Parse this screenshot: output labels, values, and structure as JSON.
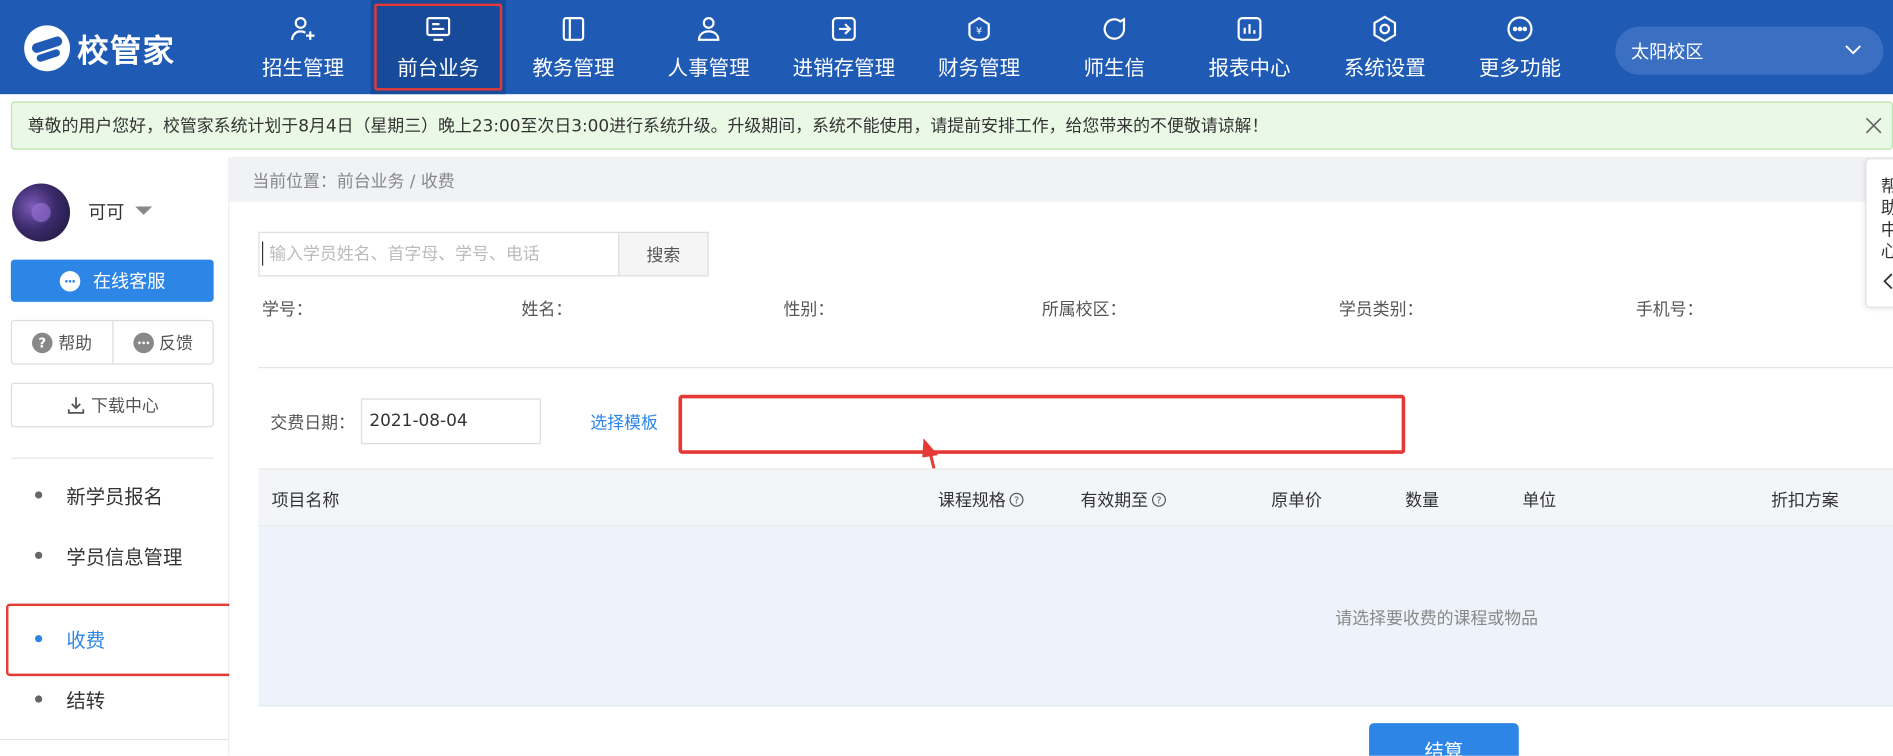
{
  "header": {
    "logo_text": "校管家",
    "nav": [
      {
        "label": "招生管理",
        "icon": "user-plus-icon"
      },
      {
        "label": "前台业务",
        "icon": "desk-icon"
      },
      {
        "label": "教务管理",
        "icon": "book-icon"
      },
      {
        "label": "人事管理",
        "icon": "person-icon"
      },
      {
        "label": "进销存管理",
        "icon": "stock-icon"
      },
      {
        "label": "财务管理",
        "icon": "finance-icon"
      },
      {
        "label": "师生信",
        "icon": "chat-icon"
      },
      {
        "label": "报表中心",
        "icon": "report-icon"
      },
      {
        "label": "系统设置",
        "icon": "settings-icon"
      },
      {
        "label": "更多功能",
        "icon": "more-icon"
      }
    ],
    "active_nav": "前台业务",
    "campus": "太阳校区"
  },
  "notice": {
    "text": "尊敬的用户您好，校管家系统计划于8月4日（星期三）晚上23:00至次日3:00进行系统升级。升级期间，系统不能使用，请提前安排工作，给您带来的不便敬请谅解！"
  },
  "sidebar": {
    "user_name": "可可",
    "customer_service": "在线客服",
    "help": "帮助",
    "feedback": "反馈",
    "download_center": "下载中心",
    "menu": [
      {
        "label": "新学员报名"
      },
      {
        "label": "学员信息管理"
      },
      {
        "label": "收费",
        "active": true
      },
      {
        "label": "结转"
      }
    ]
  },
  "breadcrumb": "当前位置：前台业务 / 收费",
  "search": {
    "placeholder": "输入学员姓名、首字母、学号、电话",
    "button": "搜索"
  },
  "student_info": {
    "fields": [
      "学号：",
      "姓名：",
      "性别：",
      "所属校区：",
      "学员类别：",
      "手机号："
    ]
  },
  "fee": {
    "date_label": "交费日期：",
    "date_value": "2021-08-04",
    "template_link": "选择模板"
  },
  "table": {
    "headers": [
      "项目名称",
      "课程规格",
      "有效期至",
      "原单价",
      "数量",
      "单位",
      "折扣方案"
    ],
    "empty_text": "请选择要收费的课程或物品"
  },
  "settle_button": "结算",
  "help_panel": {
    "text": "帮助中心"
  },
  "colors": {
    "header_bg": "#1f5bb4",
    "accent": "#2d86e6",
    "annotation_red": "#e53935"
  }
}
